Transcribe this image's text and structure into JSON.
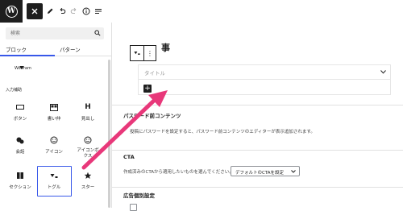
{
  "toolbar": {
    "logo": "W",
    "icons": [
      "close-icon",
      "pencil-icon",
      "undo-icon",
      "redo-icon",
      "info-icon",
      "list-view-icon"
    ]
  },
  "inserter": {
    "search_placeholder": "検索",
    "tabs": [
      "ブロック",
      "パターン"
    ],
    "wolfram_label": "Wolfram",
    "category_label": "入力補助",
    "blocks_row1": [
      "ボタン",
      "書い仲",
      "見出し"
    ],
    "blocks_row2": [
      "会話",
      "アイコン",
      "アイコンボ\nクス"
    ],
    "blocks_row3": [
      "セクション",
      "トグル",
      "スター"
    ]
  },
  "editor": {
    "title_fragment": "事",
    "toggle_title": "タイトル"
  },
  "meta": {
    "password_heading": "パスワード前コンテンツ",
    "password_desc": "投稿にパスワードを設定すると、パスワード前コンテンツのエディターが表示追加されます。",
    "cta_heading": "CTA",
    "cta_desc": "作成済みのCTAから適用したいものを選んでください。",
    "cta_select": "デフォルトのCTAを設定",
    "ad_heading": "広告個別設定"
  },
  "colors": {
    "accent": "#3858e9",
    "arrow": "#e8387a",
    "dark": "#1e1e1e"
  }
}
